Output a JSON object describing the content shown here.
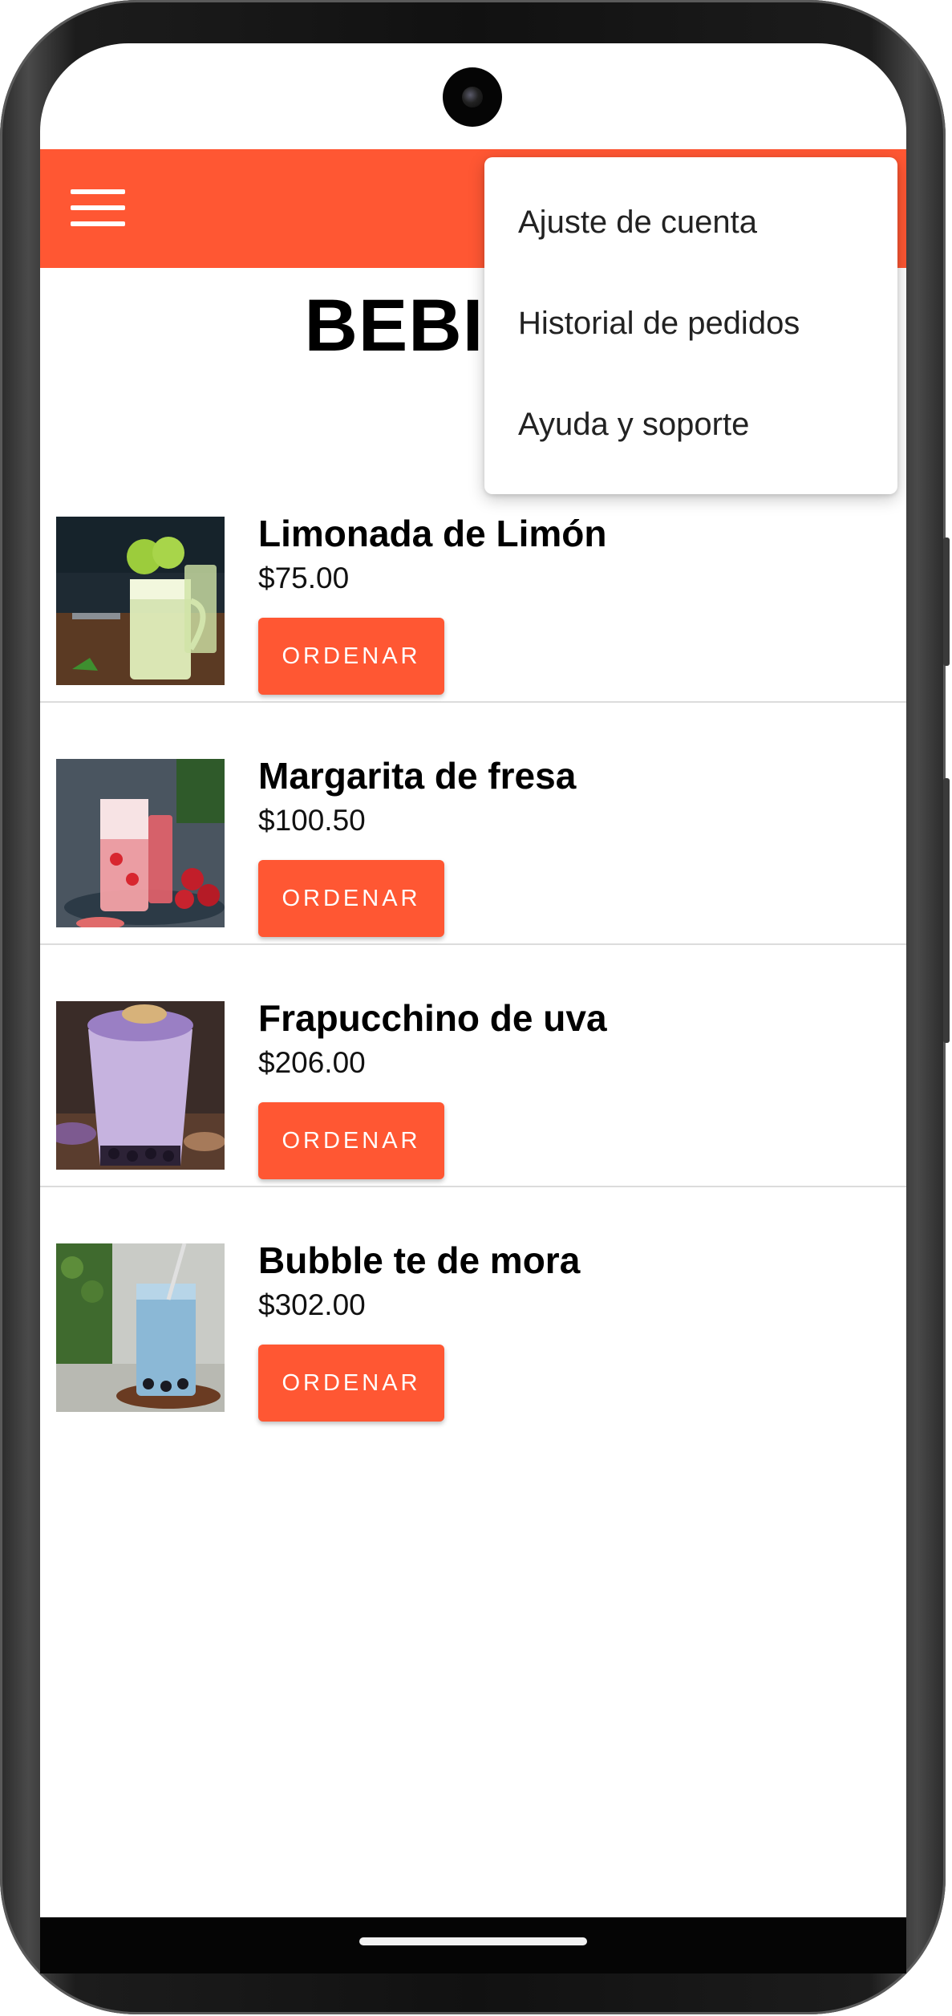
{
  "app": {
    "page_title": "BEBIDAS"
  },
  "colors": {
    "accent": "#ff5733",
    "background": "#ffffff"
  },
  "icons": {
    "menu": "hamburger-menu-icon"
  },
  "menu": {
    "items": [
      {
        "label": "Ajuste de cuenta"
      },
      {
        "label": "Historial de pedidos"
      },
      {
        "label": "Ayuda y soporte"
      }
    ]
  },
  "products": [
    {
      "name": "Limonada de Limón",
      "price": "$75.00",
      "button": "ORDENAR"
    },
    {
      "name": "Margarita de fresa",
      "price": "$100.50",
      "button": "ORDENAR"
    },
    {
      "name": "Frapucchino de uva",
      "price": "$206.00",
      "button": "ORDENAR"
    },
    {
      "name": "Bubble te de mora",
      "price": "$302.00",
      "button": "ORDENAR"
    }
  ]
}
